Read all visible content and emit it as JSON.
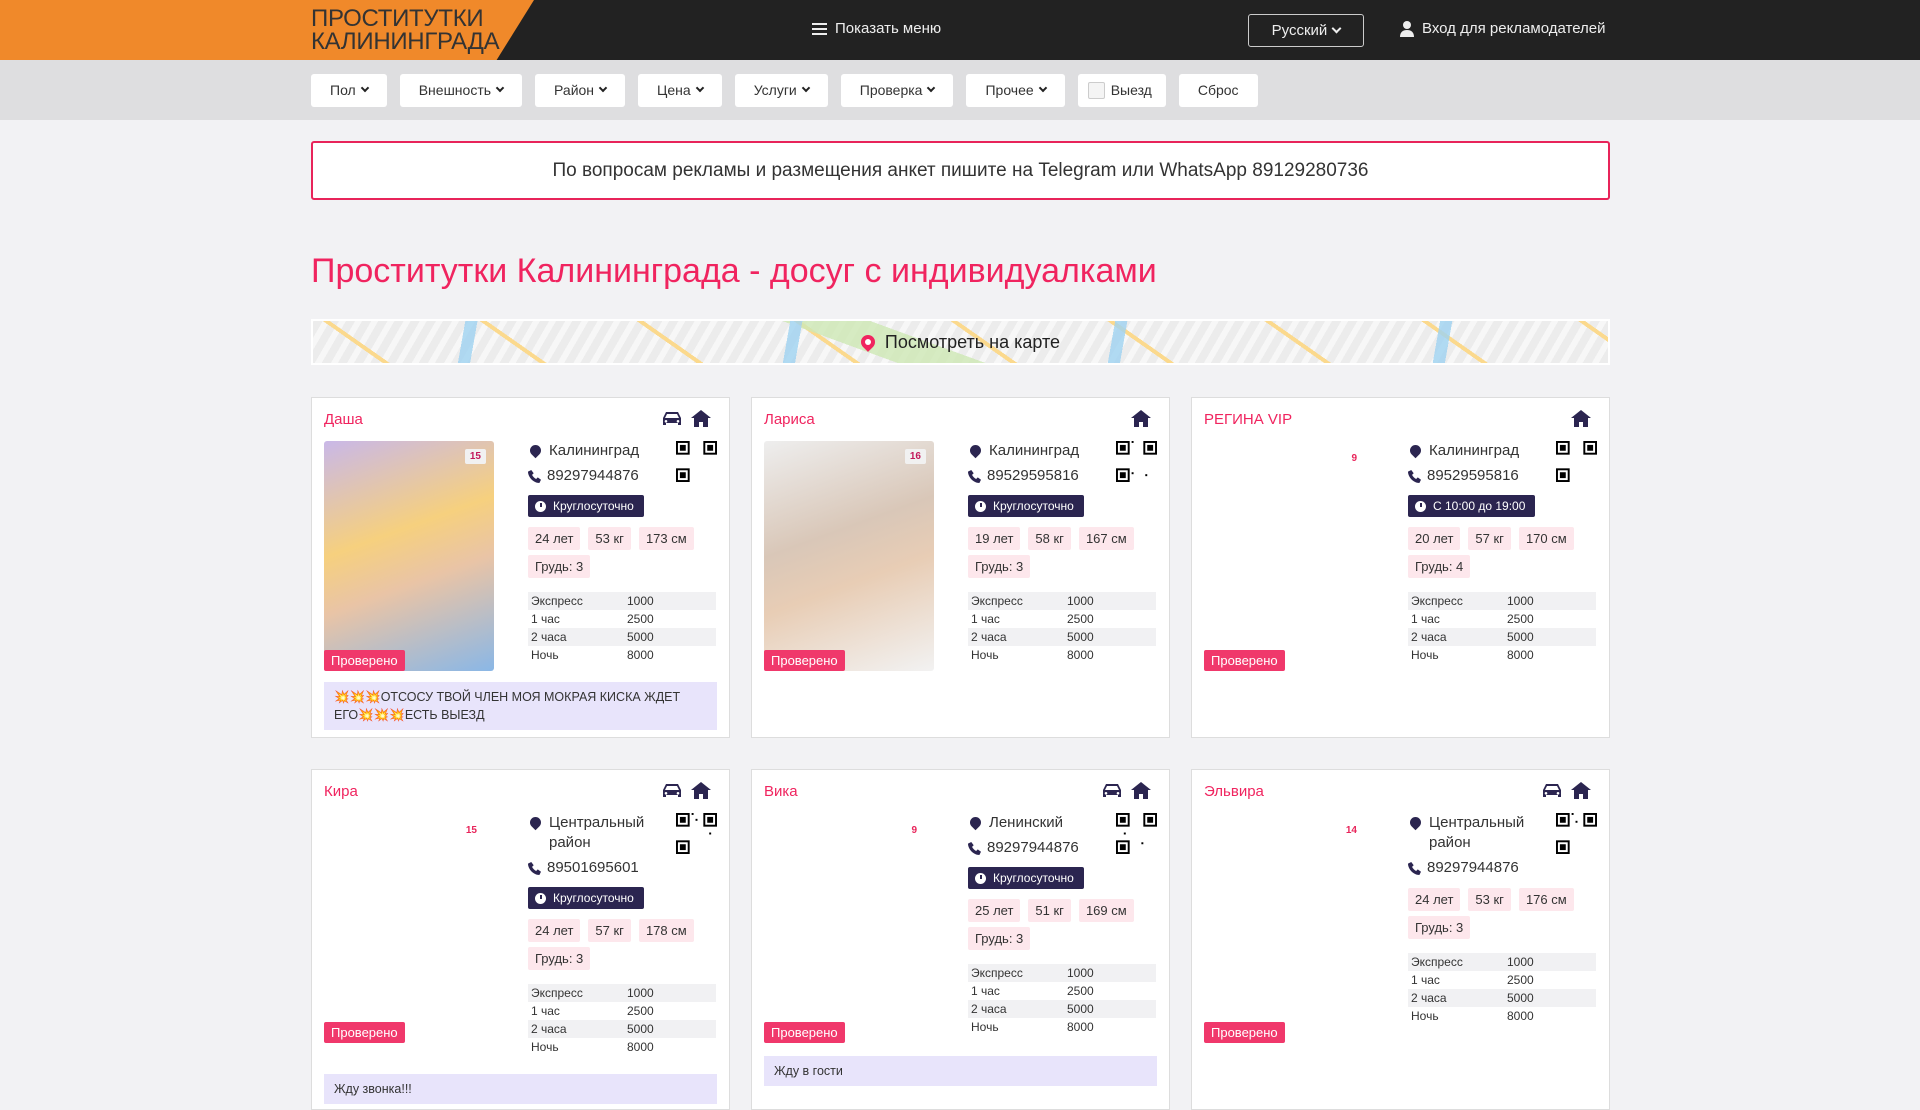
{
  "header": {
    "logo_line1": "ПРОСТИТУТКИ",
    "logo_line2": "КАЛИНИНГРАДА",
    "menu_label": "Показать меню",
    "language": "Русский",
    "login_label": "Вход для рекламодателей"
  },
  "filters": [
    "Пол",
    "Внешность",
    "Район",
    "Цена",
    "Услуги",
    "Проверка",
    "Прочее"
  ],
  "filter_checkbox": "Выезд",
  "filter_reset": "Сброс",
  "banner": "По вопросам рекламы и размещения анкет пишите на Telegram или WhatsApp 89129280736",
  "page_title": "Проститутки Калининграда - досуг с индивидуалками",
  "map_label": "Посмотреть на карте",
  "colors": {
    "accent": "#f0245f",
    "header": "#222222",
    "logo_bg": "#f0892a",
    "navy": "#2b2550"
  },
  "verified_label": "Проверено",
  "price_labels": [
    "Экспресс",
    "1 час",
    "2 часа",
    "Ночь"
  ],
  "cards": [
    {
      "name": "Даша",
      "car": true,
      "photo": 1,
      "photo_count": "15",
      "location": "Калининград",
      "phone": "89297944876",
      "hours": "Круглосуточно",
      "age": "24 лет",
      "weight": "53 кг",
      "height": "173 см",
      "chest": "Грудь: 3",
      "prices": [
        "1000",
        "2500",
        "5000",
        "8000"
      ],
      "description": "💥💥💥ОТСОСУ ТВОЙ ЧЛЕН МОЯ МОКРАЯ КИСКА ЖДЕТ ЕГО💥💥💥ЕСТЬ ВЫЕЗД"
    },
    {
      "name": "Лариса",
      "car": false,
      "photo": 2,
      "photo_count": "16",
      "location": "Калининград",
      "phone": "89529595816",
      "hours": "Круглосуточно",
      "age": "19 лет",
      "weight": "58 кг",
      "height": "167 см",
      "chest": "Грудь: 3",
      "prices": [
        "1000",
        "2500",
        "5000",
        "8000"
      ],
      "description": ""
    },
    {
      "name": "РЕГИНА VIP",
      "car": false,
      "photo": 0,
      "photo_count": "9",
      "location": "Калининград",
      "phone": "89529595816",
      "hours": "С 10:00 до 19:00",
      "age": "20 лет",
      "weight": "57 кг",
      "height": "170 см",
      "chest": "Грудь: 4",
      "prices": [
        "1000",
        "2500",
        "5000",
        "8000"
      ],
      "description": ""
    },
    {
      "name": "Кира",
      "car": true,
      "photo": 0,
      "photo_count": "15",
      "location": "Центральный район",
      "phone": "89501695601",
      "hours": "Круглосуточно",
      "age": "24 лет",
      "weight": "57 кг",
      "height": "178 см",
      "chest": "Грудь: 3",
      "prices": [
        "1000",
        "2500",
        "5000",
        "8000"
      ],
      "description": "Жду звонка!!!"
    },
    {
      "name": "Вика",
      "car": true,
      "photo": 0,
      "photo_count": "9",
      "location": "Ленинский",
      "phone": "89297944876",
      "hours": "Круглосуточно",
      "age": "25 лет",
      "weight": "51 кг",
      "height": "169 см",
      "chest": "Грудь: 3",
      "prices": [
        "1000",
        "2500",
        "5000",
        "8000"
      ],
      "description": "Жду в гости"
    },
    {
      "name": "Эльвира",
      "car": true,
      "photo": 0,
      "photo_count": "14",
      "location": "Центральный район",
      "phone": "89297944876",
      "hours": "",
      "age": "24 лет",
      "weight": "53 кг",
      "height": "176 см",
      "chest": "Грудь: 3",
      "prices": [
        "1000",
        "2500",
        "5000",
        "8000"
      ],
      "description": ""
    }
  ]
}
